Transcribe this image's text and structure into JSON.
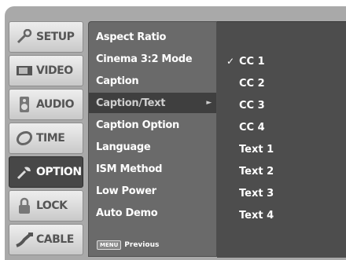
{
  "tabs": [
    {
      "label": "SETUP",
      "icon": "setup-icon",
      "active": false
    },
    {
      "label": "VIDEO",
      "icon": "video-icon",
      "active": false
    },
    {
      "label": "AUDIO",
      "icon": "audio-icon",
      "active": false
    },
    {
      "label": "TIME",
      "icon": "time-icon",
      "active": false
    },
    {
      "label": "OPTION",
      "icon": "option-icon",
      "active": true
    },
    {
      "label": "LOCK",
      "icon": "lock-icon",
      "active": false
    },
    {
      "label": "CABLE",
      "icon": "cable-icon",
      "active": false
    }
  ],
  "menu": {
    "items": [
      {
        "label": "Aspect Ratio"
      },
      {
        "label": "Cinema 3:2 Mode"
      },
      {
        "label": "Caption"
      },
      {
        "label": "Caption/Text",
        "highlighted": true,
        "arrow": "►"
      },
      {
        "label": "Caption Option"
      },
      {
        "label": "Language"
      },
      {
        "label": "ISM Method"
      },
      {
        "label": "Low Power"
      },
      {
        "label": "Auto Demo"
      }
    ],
    "previous": {
      "key": "MENU",
      "label": "Previous"
    }
  },
  "submenu": {
    "items": [
      {
        "label": "CC 1",
        "checked": true,
        "check": "✓"
      },
      {
        "label": "CC 2"
      },
      {
        "label": "CC 3"
      },
      {
        "label": "CC 4"
      },
      {
        "label": "Text 1"
      },
      {
        "label": "Text 2"
      },
      {
        "label": "Text 3"
      },
      {
        "label": "Text 4"
      }
    ]
  },
  "colors": {
    "frame": "#a9a9a9",
    "menu": "#6a6a6a",
    "submenu": "#4d4d4d",
    "active_tab": "#474747"
  }
}
